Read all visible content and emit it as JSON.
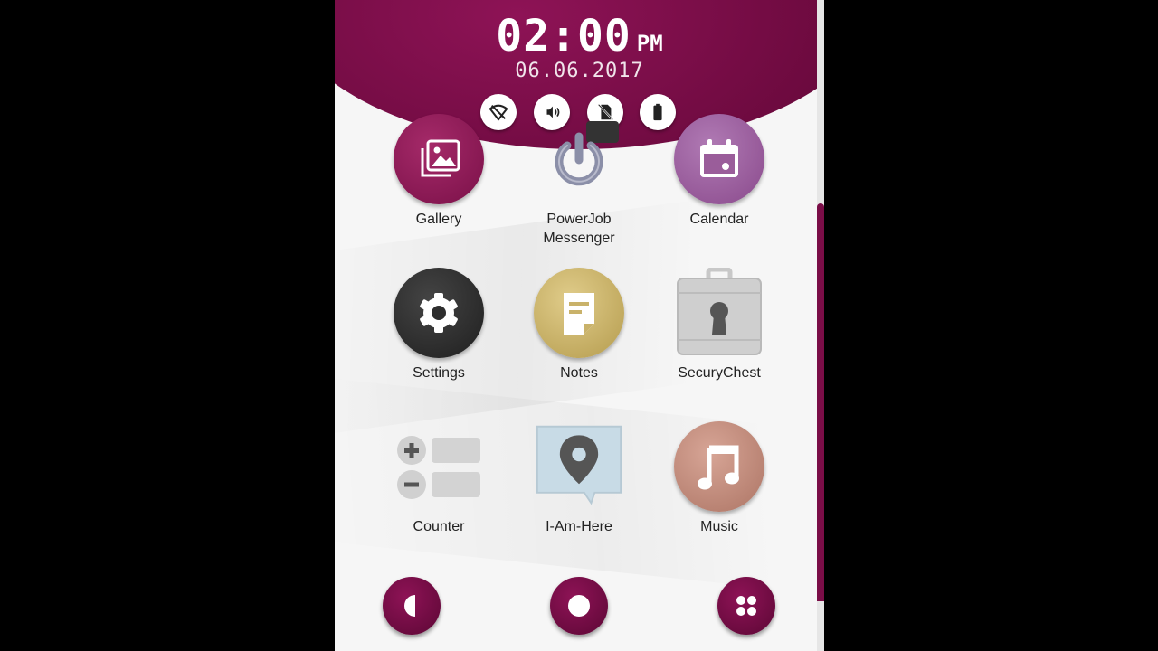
{
  "clock": {
    "time": "02:00",
    "ampm": "PM",
    "date": "06.06.2017"
  },
  "status_icons": [
    "wifi-off-icon",
    "volume-icon",
    "no-sim-icon",
    "battery-icon"
  ],
  "apps": [
    {
      "label": "Gallery",
      "icon": "gallery-icon",
      "color": "#8a1a55"
    },
    {
      "label": "PowerJob\nMessenger",
      "icon": "power-icon",
      "color": "#8b8fa8"
    },
    {
      "label": "Calendar",
      "icon": "calendar-icon",
      "color": "#9a5d9a"
    },
    {
      "label": "Settings",
      "icon": "gear-icon",
      "color": "#2e2e2e"
    },
    {
      "label": "Notes",
      "icon": "note-icon",
      "color": "#c9b26a"
    },
    {
      "label": "SecuryChest",
      "icon": "lock-chest-icon",
      "color": "#c8c8c8"
    },
    {
      "label": "Counter",
      "icon": "counter-icon",
      "color": "#cfcfcf"
    },
    {
      "label": "I-Am-Here",
      "icon": "map-pin-icon",
      "color": "#c8dbe6"
    },
    {
      "label": "Music",
      "icon": "music-icon",
      "color": "#c08a7c"
    }
  ],
  "dock": [
    "half-moon-icon",
    "home-icon",
    "apps-grid-icon"
  ],
  "colors": {
    "accent": "#7a0d47",
    "background": "#f6f6f6"
  }
}
